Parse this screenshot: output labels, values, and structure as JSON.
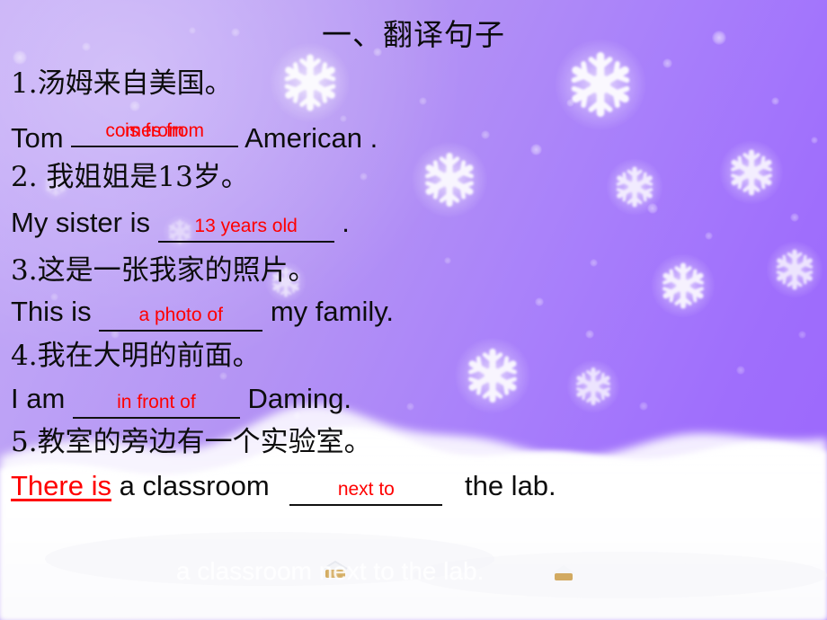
{
  "slide": {
    "title": "一、翻译句子",
    "background": {
      "sky_top_left_color": "#c3a9f7",
      "sky_top_right_color": "#9b66fc",
      "snow_color": "#ffffff",
      "snowflake_color": "#ffffff"
    },
    "text_colors": {
      "body": "#111111",
      "answer": "#ff0000",
      "ghost": "#ffffff"
    }
  },
  "exercises": [
    {
      "number": "1.",
      "chinese": "1.汤姆来自美国。",
      "english_prefix": "Tom",
      "answers": [
        "comes from",
        "is from"
      ],
      "overlapping": true,
      "english_suffix": "American ."
    },
    {
      "number": "2.",
      "chinese": "2. 我姐姐是13岁。",
      "english_prefix": "My sister is",
      "answers": [
        "13 years old"
      ],
      "overlapping": false,
      "english_suffix": "."
    },
    {
      "number": "3.",
      "chinese": "3.这是一张我家的照片。",
      "english_prefix": "This is",
      "answers": [
        "a photo of"
      ],
      "overlapping": false,
      "english_suffix": "my family."
    },
    {
      "number": "4.",
      "chinese": "4.我在大明的前面。",
      "english_prefix": "I am",
      "answers": [
        "in front of"
      ],
      "overlapping": false,
      "english_suffix": "Daming."
    },
    {
      "number": "5.",
      "chinese": "5.教室的旁边有一个实验室。",
      "english_prefix_red": "There is",
      "english_prefix": "a classroom",
      "answers": [
        "next to"
      ],
      "overlapping": false,
      "english_suffix": "the lab."
    }
  ],
  "ghost_text": "a classroom next to the lab."
}
